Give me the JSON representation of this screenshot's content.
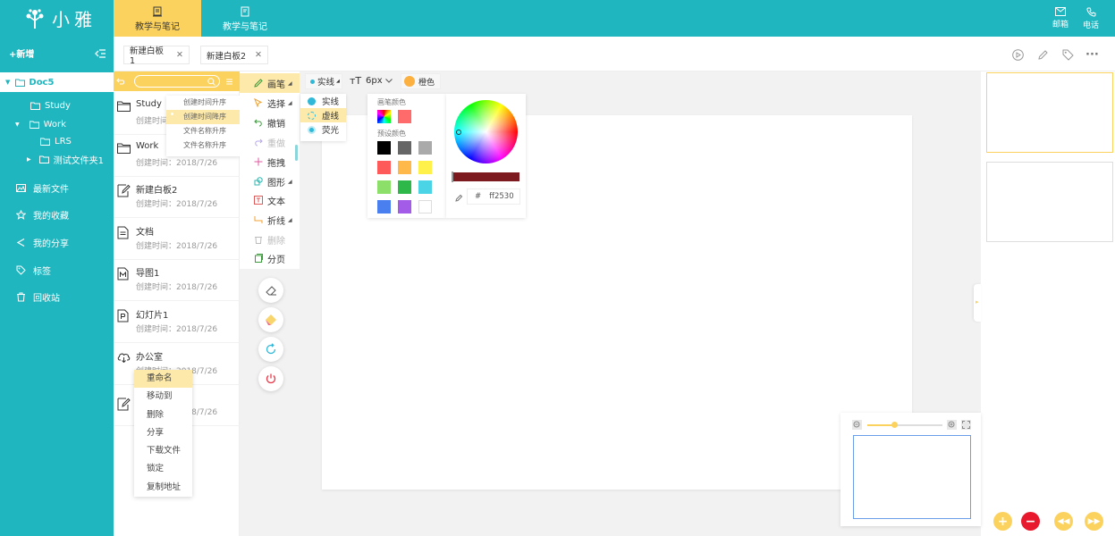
{
  "app": {
    "name": "小雅"
  },
  "top_tabs": [
    {
      "label": "教学与笔记",
      "active": true
    },
    {
      "label": "教学与笔记",
      "active": false
    }
  ],
  "top_right": {
    "mail": "邮箱",
    "phone": "电话"
  },
  "sidebar": {
    "new_label": "+新增",
    "tree": [
      {
        "label": "Doc5",
        "selected": true
      },
      {
        "label": "Study"
      },
      {
        "label": "Work"
      },
      {
        "label": "LRS"
      },
      {
        "label": "测试文件夹1"
      }
    ],
    "nav": [
      {
        "label": "最新文件",
        "icon": "image-icon"
      },
      {
        "label": "我的收藏",
        "icon": "star-icon"
      },
      {
        "label": "我的分享",
        "icon": "share-icon"
      },
      {
        "label": "标签",
        "icon": "tag-icon"
      },
      {
        "label": "回收站",
        "icon": "trash-icon"
      }
    ]
  },
  "doc_tabs": [
    "新建白板1",
    "新建白板2"
  ],
  "sort_menu": [
    "创建时间升序",
    "创建时间降序",
    "文件名称升序",
    "文件名称升序"
  ],
  "files": [
    {
      "name": "Study",
      "time": "创建时间：2018/7/26"
    },
    {
      "name": "Work",
      "time": "创建时间：2018/7/26"
    },
    {
      "name": "新建白板2",
      "time": "创建时间：2018/7/26"
    },
    {
      "name": "文档",
      "time": "创建时间：2018/7/26"
    },
    {
      "name": "导图1",
      "time": "创建时间：2018/7/26"
    },
    {
      "name": "幻灯片1",
      "time": "创建时间：2018/7/26"
    },
    {
      "name": "办公室",
      "time": "创建时间：2018/7/26"
    },
    {
      "name": "",
      "time": "创建时间：2018/7/26"
    }
  ],
  "context_menu": [
    "重命名",
    "移动到",
    "删除",
    "分享",
    "下载文件",
    "锁定",
    "复制地址"
  ],
  "tools": [
    "画笔",
    "选择",
    "撤销",
    "重做",
    "拖拽",
    "图形",
    "文本",
    "折线",
    "删除",
    "分页"
  ],
  "pen_bar": {
    "line_style": "实线",
    "font_icon": "тT",
    "size": "6px",
    "color_name": "橙色"
  },
  "line_menu": [
    "实线",
    "虚线",
    "荧光"
  ],
  "color_panel": {
    "title_pen": "画笔颜色",
    "title_preset": "预设颜色",
    "recent": [
      "#ff6b6b"
    ],
    "presets": [
      "#000000",
      "#666666",
      "#aaaaaa",
      "#ff5a5a",
      "#ffb84a",
      "#fff04a",
      "#8ce06a",
      "#2fb84a",
      "#4ad4e6",
      "#4a7ff0",
      "#a35ce8",
      "#ffffff"
    ]
  },
  "color_value": {
    "hash": "#",
    "hex": "ff2530"
  },
  "colors": {
    "teal": "#1fb6bf",
    "yellow": "#fcd25f",
    "sel": "#fde9a9"
  }
}
